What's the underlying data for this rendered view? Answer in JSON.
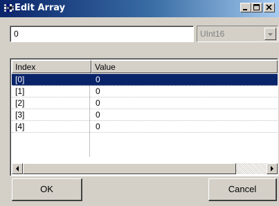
{
  "window": {
    "title": "Edit Array",
    "app_icon": "array-icon",
    "controls": {
      "minimize": "minimize-icon",
      "maximize": "maximize-icon",
      "close": "close-icon"
    }
  },
  "editor": {
    "value": "0",
    "type": "UInt16"
  },
  "list": {
    "columns": [
      "Index",
      "Value"
    ],
    "rows": [
      {
        "index": "[0]",
        "value": "0",
        "selected": true
      },
      {
        "index": "[1]",
        "value": "0",
        "selected": false
      },
      {
        "index": "[2]",
        "value": "0",
        "selected": false
      },
      {
        "index": "[3]",
        "value": "0",
        "selected": false
      },
      {
        "index": "[4]",
        "value": "0",
        "selected": false
      }
    ]
  },
  "buttons": {
    "ok": "OK",
    "cancel": "Cancel"
  },
  "colors": {
    "titlebar_start": "#0a246a",
    "titlebar_end": "#a6caf0",
    "selection": "#0a246a",
    "face": "#d4d0c8"
  }
}
